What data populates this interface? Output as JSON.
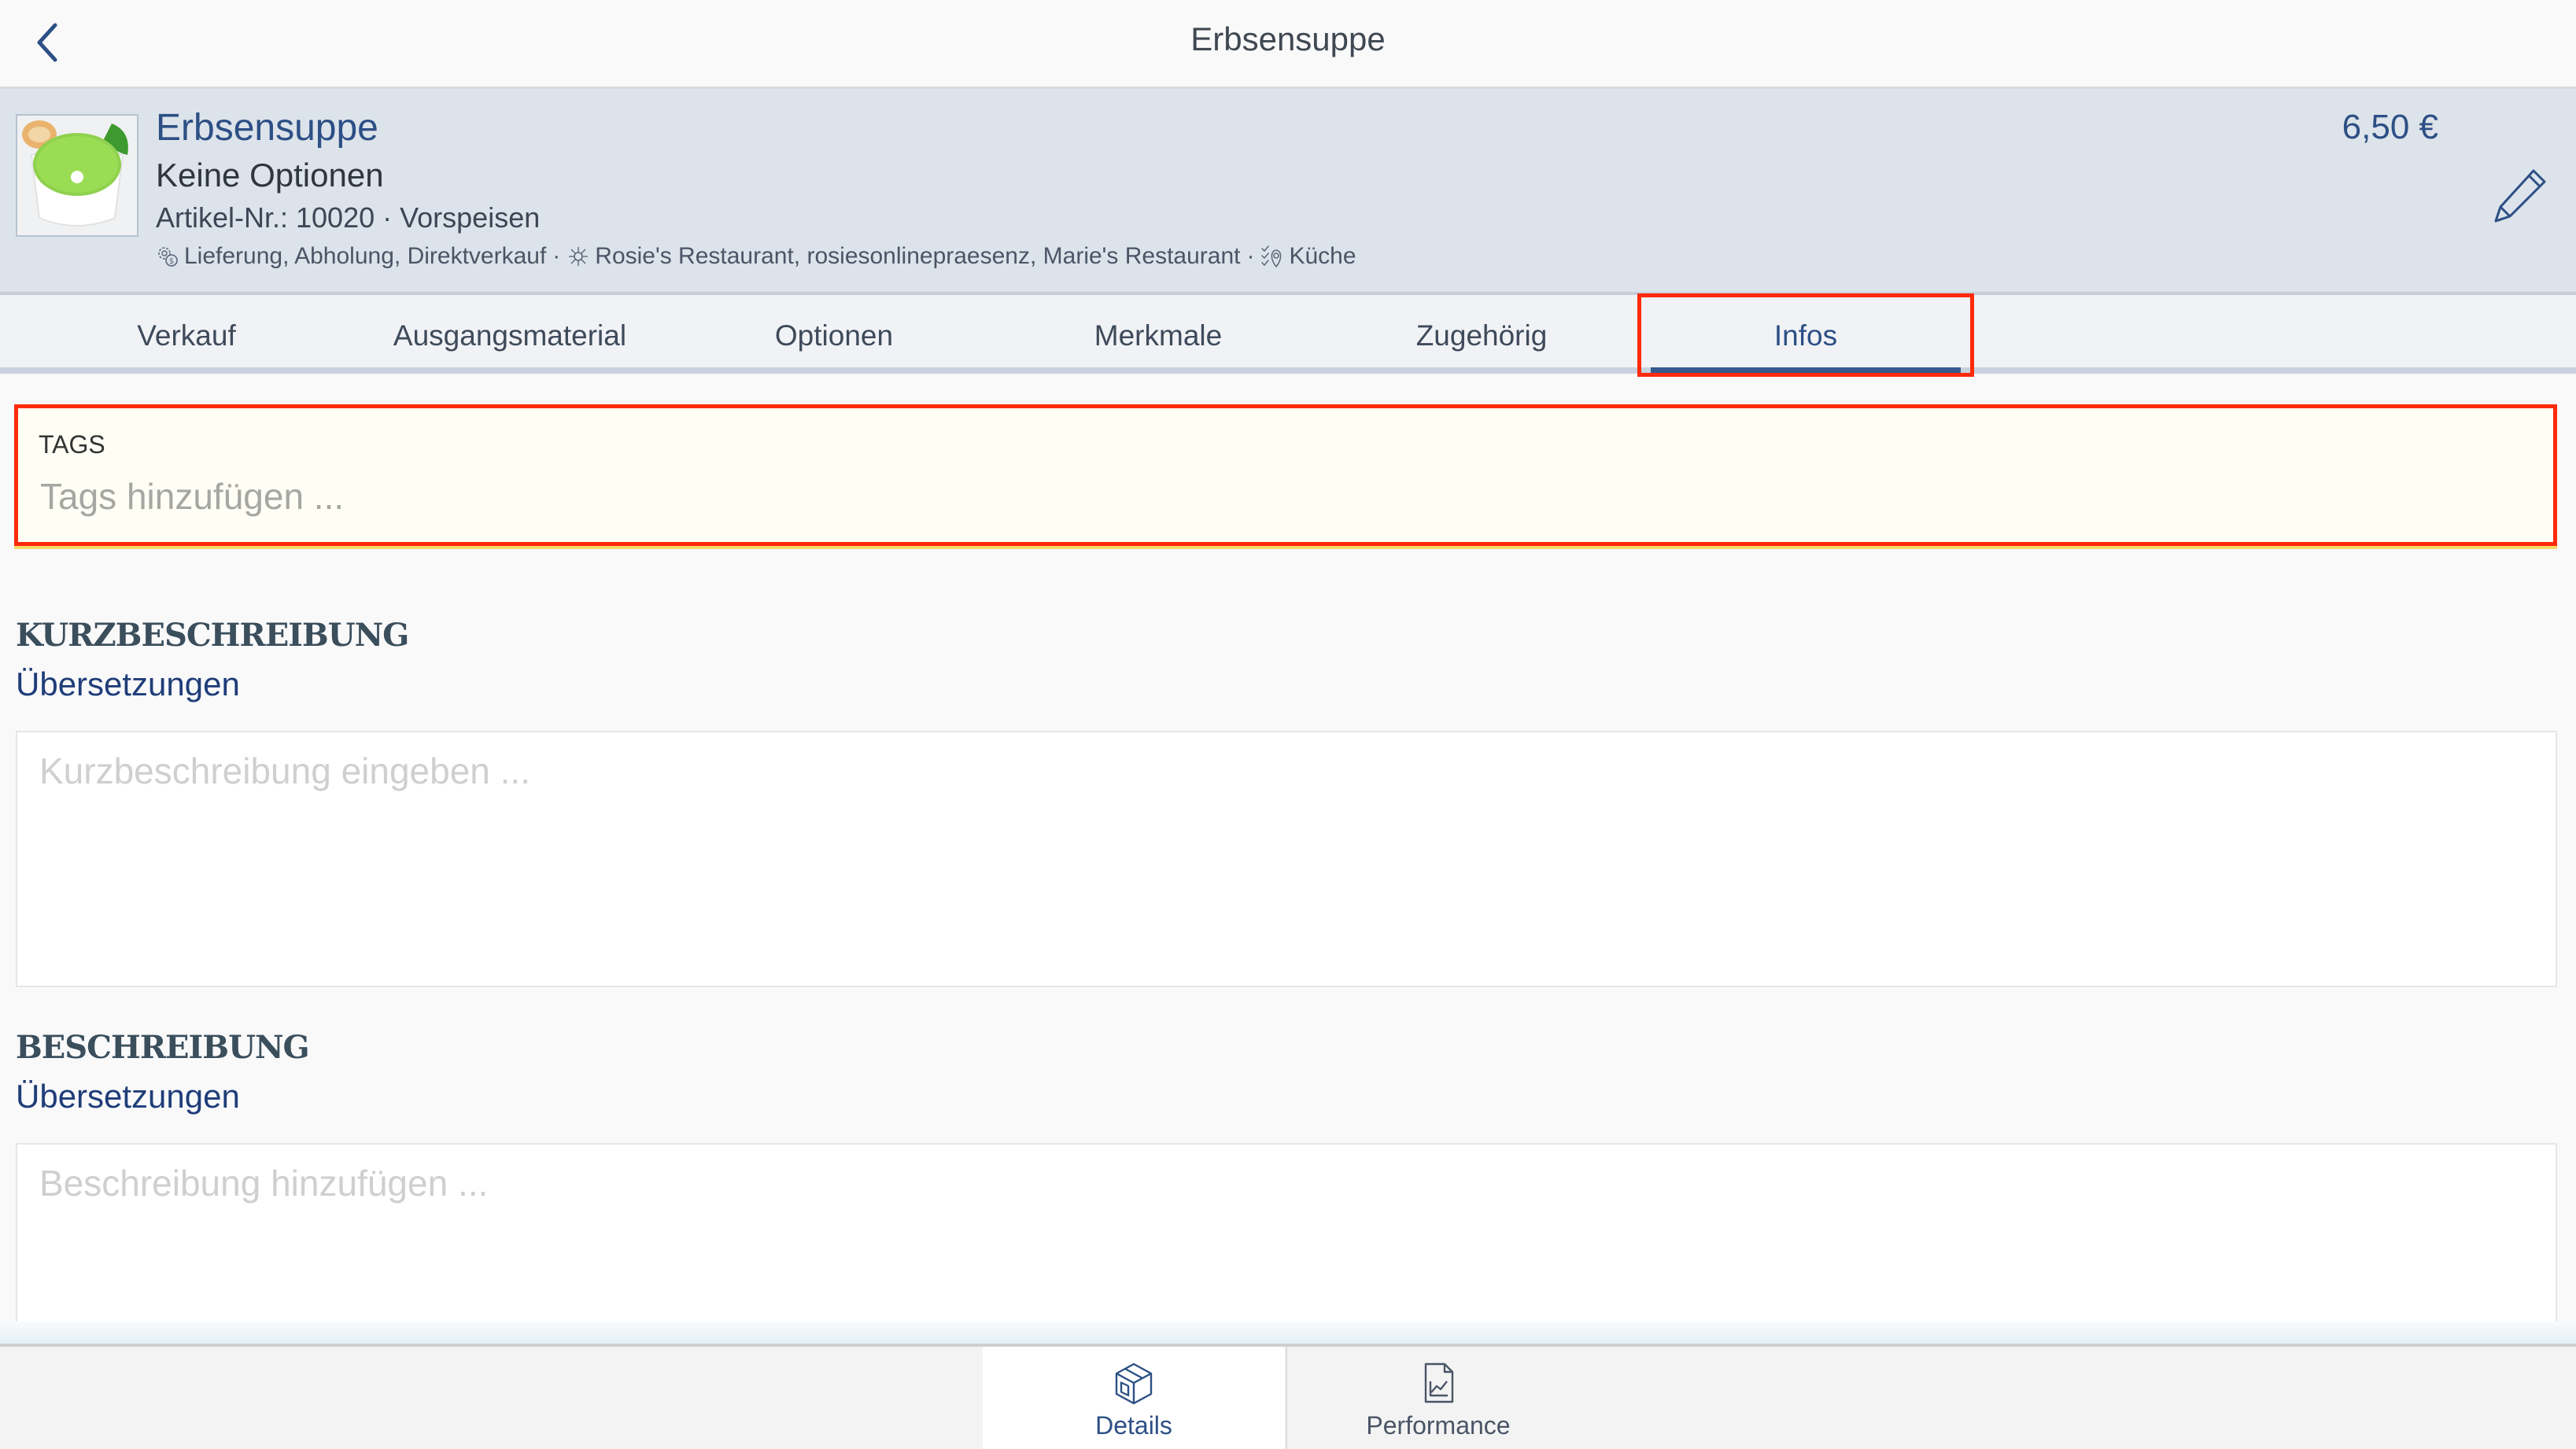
{
  "topbar": {
    "title": "Erbsensuppe",
    "back_icon": "chevron-left-icon"
  },
  "product": {
    "name": "Erbsensuppe",
    "options": "Keine Optionen",
    "article_line": "Artikel-Nr.: 10020 · Vorspeisen",
    "sales_channels": "Lieferung, Abholung, Direktverkauf",
    "locations": "Rosie's Restaurant, rosiesonlinepraesenz, Marie's Restaurant",
    "production": "Küche",
    "separator": "·",
    "price": "6,50 €",
    "edit_icon": "pencil-icon"
  },
  "tabs": [
    {
      "label": "Verkauf",
      "active": false
    },
    {
      "label": "Ausgangsmaterial",
      "active": false
    },
    {
      "label": "Optionen",
      "active": false
    },
    {
      "label": "Merkmale",
      "active": false
    },
    {
      "label": "Zugehörig",
      "active": false
    },
    {
      "label": "Infos",
      "active": true
    }
  ],
  "tags": {
    "label": "TAGS",
    "value": "",
    "placeholder": "Tags hinzufügen ..."
  },
  "short_description": {
    "title": "KURZBESCHREIBUNG",
    "translations_link": "Übersetzungen",
    "value": "",
    "placeholder": "Kurzbeschreibung eingeben ..."
  },
  "description": {
    "title": "BESCHREIBUNG",
    "translations_link": "Übersetzungen",
    "value": "",
    "placeholder": "Beschreibung hinzufügen ..."
  },
  "bottom_nav": [
    {
      "label": "Details",
      "icon": "box-icon",
      "active": true
    },
    {
      "label": "Performance",
      "icon": "chart-document-icon",
      "active": false
    }
  ],
  "colors": {
    "accent": "#2c4f85",
    "highlight": "#ff2a0a",
    "header_bg": "#dde3ea"
  }
}
